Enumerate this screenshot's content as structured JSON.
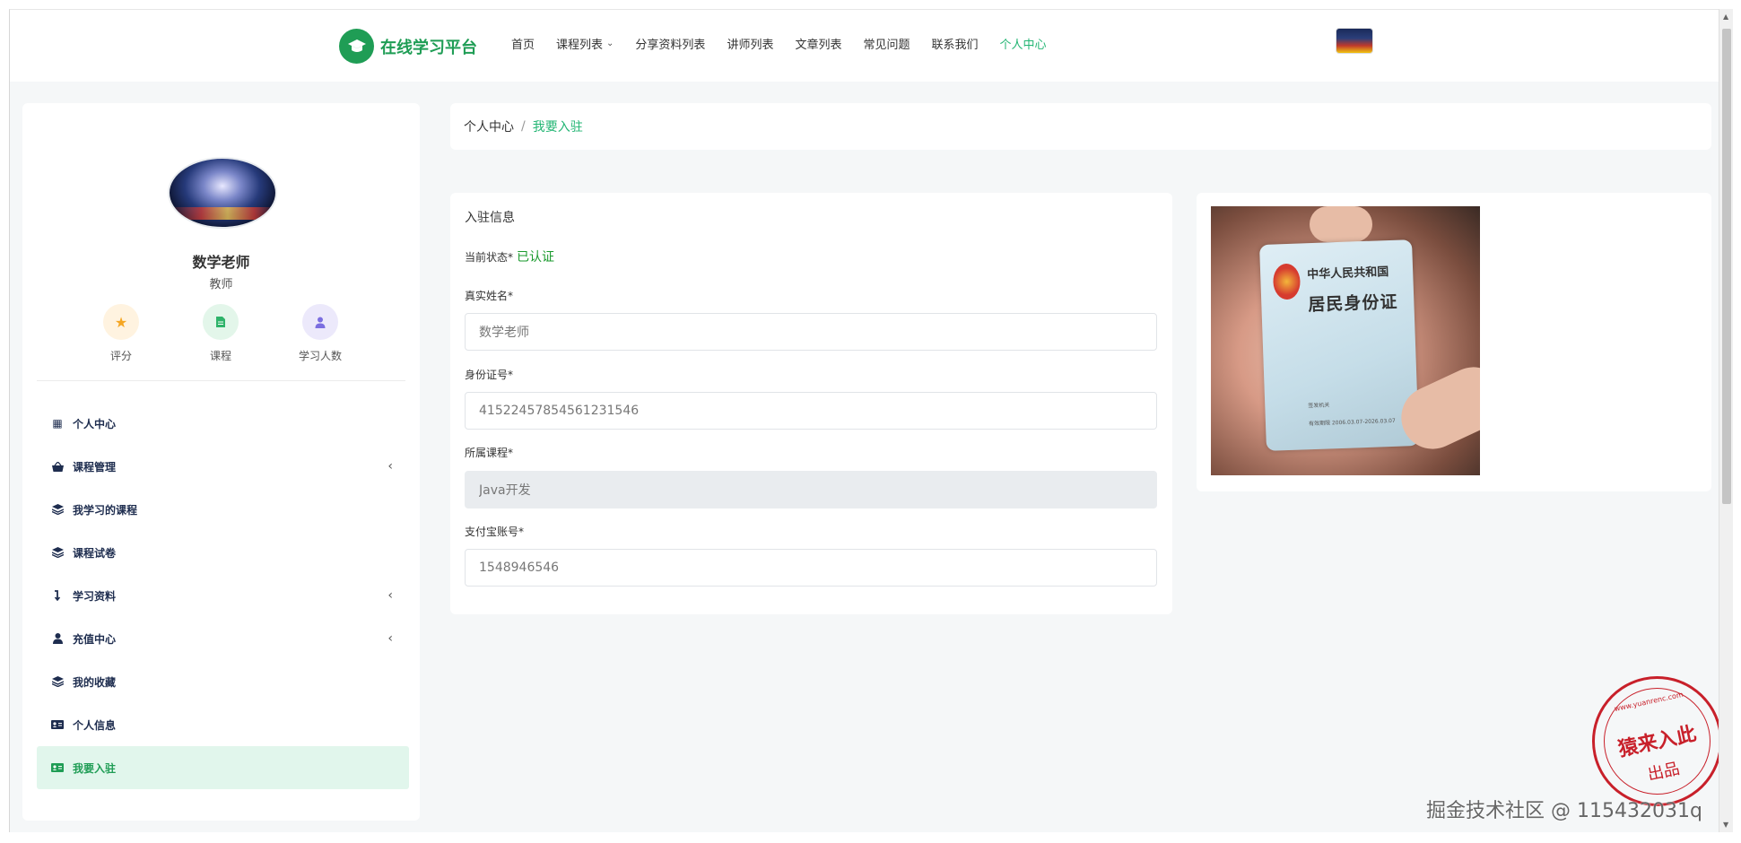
{
  "header": {
    "logo_text": "在线学习平台",
    "nav": [
      {
        "label": "首页",
        "active": false,
        "dropdown": false
      },
      {
        "label": "课程列表",
        "active": false,
        "dropdown": true
      },
      {
        "label": "分享资料列表",
        "active": false,
        "dropdown": false
      },
      {
        "label": "讲师列表",
        "active": false,
        "dropdown": false
      },
      {
        "label": "文章列表",
        "active": false,
        "dropdown": false
      },
      {
        "label": "常见问题",
        "active": false,
        "dropdown": false
      },
      {
        "label": "联系我们",
        "active": false,
        "dropdown": false
      },
      {
        "label": "个人中心",
        "active": true,
        "dropdown": false
      }
    ]
  },
  "profile": {
    "name": "数学老师",
    "role": "教师",
    "stats": [
      {
        "label": "评分",
        "icon": "star-icon",
        "bg": "#fff3e0",
        "color": "#f5a623"
      },
      {
        "label": "课程",
        "icon": "document-icon",
        "bg": "#e3f6ea",
        "color": "#2fb36a"
      },
      {
        "label": "学习人数",
        "icon": "user-icon",
        "bg": "#ece9fb",
        "color": "#7b6ee0"
      }
    ]
  },
  "menu": [
    {
      "label": "个人中心",
      "icon": "grid-icon",
      "glyph": "▦",
      "arrow": false,
      "active": false
    },
    {
      "label": "课程管理",
      "icon": "basket-icon",
      "glyph": "⌂",
      "arrow": true,
      "active": false
    },
    {
      "label": "我学习的课程",
      "icon": "layers-icon",
      "glyph": "≋",
      "arrow": false,
      "active": false
    },
    {
      "label": "课程试卷",
      "icon": "layers-icon",
      "glyph": "≋",
      "arrow": false,
      "active": false
    },
    {
      "label": "学习资料",
      "icon": "level-down-icon",
      "glyph": "↴",
      "arrow": true,
      "active": false
    },
    {
      "label": "充值中心",
      "icon": "user-icon",
      "glyph": "●",
      "arrow": true,
      "active": false
    },
    {
      "label": "我的收藏",
      "icon": "layers-icon",
      "glyph": "≋",
      "arrow": false,
      "active": false
    },
    {
      "label": "个人信息",
      "icon": "id-card-icon",
      "glyph": "▤",
      "arrow": false,
      "active": false
    },
    {
      "label": "我要入驻",
      "icon": "id-card-icon",
      "glyph": "▤",
      "arrow": false,
      "active": true
    }
  ],
  "breadcrumb": {
    "parent": "个人中心",
    "separator": "/",
    "current": "我要入驻"
  },
  "form": {
    "title": "入驻信息",
    "status_label": "当前状态*",
    "status_value": "已认证",
    "fields": [
      {
        "label": "真实姓名*",
        "value": "数学老师",
        "disabled": false
      },
      {
        "label": "身份证号*",
        "value": "415224578545612315​46",
        "disabled": false
      },
      {
        "label": "所属课程*",
        "value": "Java开发",
        "disabled": true
      },
      {
        "label": "支付宝账号*",
        "value": "1548946546",
        "disabled": false
      }
    ]
  },
  "id_image": {
    "line1": "中华人民共和国",
    "line2": "居民身份证",
    "small1": "签发机关",
    "small2": "有效期限 2006.03.07-2026.03.07"
  },
  "watermark": {
    "stamp_url": "www.yuanrenc.com",
    "stamp_main": "猿来入此",
    "stamp_sub": "出品",
    "juejin": "掘金技术社区 @ 115432031q"
  },
  "colors": {
    "brand": "#1f9d55",
    "accent": "#22b573",
    "status_ok": "#1a9a2d",
    "stamp": "#c8202a"
  }
}
